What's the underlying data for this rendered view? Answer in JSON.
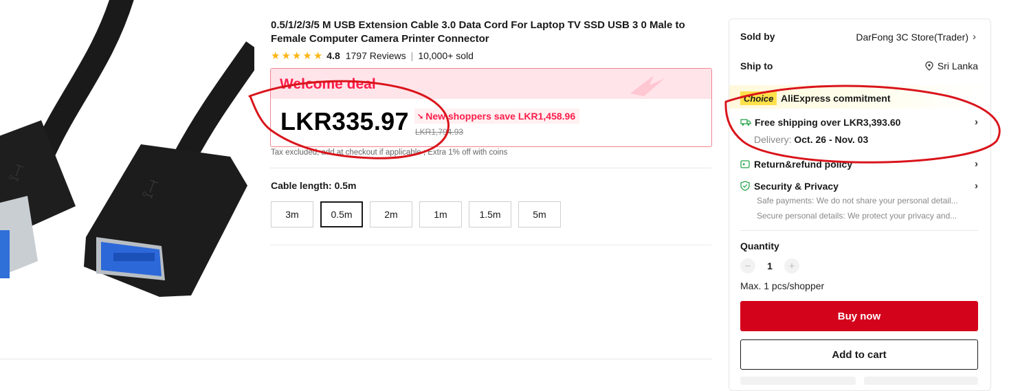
{
  "product": {
    "title": "0.5/1/2/3/5 M USB Extension Cable 3.0 Data Cord For Laptop TV SSD USB 3 0 Male to Female Computer Camera Printer Connector",
    "rating": "4.8",
    "reviews": "1797 Reviews",
    "sold": "10,000+ sold",
    "stars": 5
  },
  "deal": {
    "title": "Welcome deal",
    "price": "LKR335.97",
    "save_text": "New shoppers save LKR1,458.96",
    "old_price": "LKR1,794.93",
    "tax_note": "Tax excluded, add at checkout if applicable ; Extra 1% off with coins"
  },
  "variant": {
    "label": "Cable length:",
    "selected": "0.5m",
    "options": [
      "3m",
      "0.5m",
      "2m",
      "1m",
      "1.5m",
      "5m"
    ]
  },
  "side": {
    "sold_by_label": "Sold by",
    "sold_by_value": "DarFong 3C Store(Trader)",
    "ship_to_label": "Ship to",
    "ship_to_value": "Sri Lanka",
    "choice_badge": "Choice",
    "commitment": "AliExpress commitment",
    "free_shipping": "Free shipping over LKR3,393.60",
    "delivery_label": "Delivery:",
    "delivery_dates": "Oct. 26 - Nov. 03",
    "return_policy": "Return&refund policy",
    "security": "Security & Privacy",
    "safe_payments": "Safe payments: We do not share your personal detail...",
    "secure_details": "Secure personal details: We protect your privacy and...",
    "quantity_label": "Quantity",
    "quantity_value": "1",
    "max_note": "Max. 1 pcs/shopper",
    "buy_now": "Buy now",
    "add_to_cart": "Add to cart"
  },
  "colors": {
    "accent_red": "#d3031c",
    "deal_pink": "#fe1e4a",
    "choice_yellow": "#ffe14a",
    "star_gold": "#fdb515",
    "annotation_red": "#d9141b"
  }
}
